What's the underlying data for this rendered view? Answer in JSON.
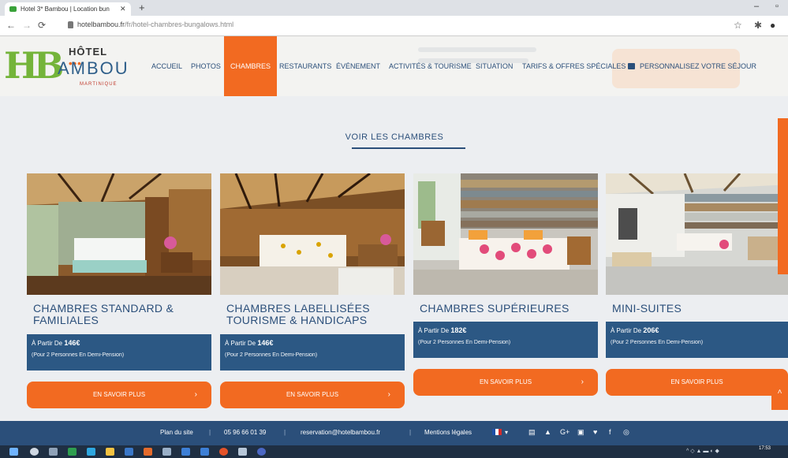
{
  "browser": {
    "tab_title": "Hotel 3* Bambou | Location bun",
    "tab_close": "✕",
    "new_tab": "+",
    "url_host": "hotelbambou.fr",
    "url_path": "/fr/hotel-chambres-bungalows.html",
    "icons": [
      "back-icon",
      "forward-icon",
      "reload-icon",
      "lock-icon",
      "star-icon",
      "extensions-icon",
      "profile-icon",
      "minimize-icon",
      "restore-icon"
    ]
  },
  "logo": {
    "hb": "HB",
    "hotel": "HÔTEL",
    "dots": "•••",
    "bambou": "AMBOU",
    "martinique": "MARTINIQUE"
  },
  "menu": {
    "items": [
      "ACCUEIL",
      "PHOTOS",
      "CHAMBRES",
      "RESTAURANTS",
      "ÉVÉNEMENT",
      "ACTIVITÉS & TOURISME",
      "SITUATION",
      "TARIFS & OFFRES SPÉCIALES",
      "PERSONNALISEZ VOTRE SÉJOUR"
    ],
    "active": "CHAMBRES"
  },
  "section": {
    "title": "VOIR LES CHAMBRES"
  },
  "rooms": [
    {
      "name_line1": "CHAMBRES STANDARD &",
      "name_line2": "FAMILIALES",
      "price_prefix": "À Partir De ",
      "price": "146€",
      "note": "(Pour 2 Personnes En Demi-Pension)",
      "cta": "EN SAVOIR PLUS"
    },
    {
      "name_line1": "CHAMBRES LABELLISÉES",
      "name_line2": "TOURISME & HANDICAPS",
      "price_prefix": "À Partir De ",
      "price": "146€",
      "note": "(Pour 2 Personnes En Demi-Pension)",
      "cta": "EN SAVOIR PLUS"
    },
    {
      "name_line1": "CHAMBRES SUPÉRIEURES",
      "name_line2": "",
      "price_prefix": "À Partir De ",
      "price": "182€",
      "note": "(Pour 2 Personnes En Demi-Pension)",
      "cta": "EN SAVOIR PLUS"
    },
    {
      "name_line1": "MINI-SUITES",
      "name_line2": "",
      "price_prefix": "À Partir De ",
      "price": "206€",
      "note": "(Pour 2 Personnes En Demi-Pension)",
      "cta": "EN SAVOIR PLUS"
    }
  ],
  "cta_chevron": "›",
  "footer": {
    "sitemap": "Plan du site",
    "phone": "05 96 66 01 39",
    "email": "reservation@hotelbambou.fr",
    "legal": "Mentions légales",
    "separator": "|",
    "lang_caret": "▾",
    "social": [
      "tripadvisor-icon",
      "instagram-icon",
      "google-plus-icon",
      "youtube-icon",
      "twitter-icon",
      "facebook-icon",
      "flickr-icon"
    ],
    "social_glyphs": [
      "▤",
      "▲",
      "G+",
      "▣",
      "♥",
      "f",
      "◎"
    ]
  },
  "taskbar": {
    "time": "17:53"
  },
  "colors": {
    "brand_blue": "#2b4f7a",
    "orange": "#f26a21",
    "price_blue": "#2c5884",
    "logo_green": "#74b43a"
  }
}
